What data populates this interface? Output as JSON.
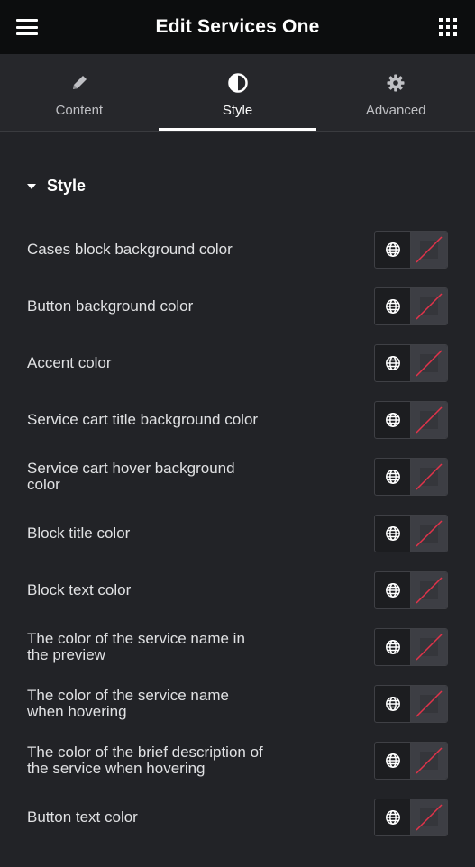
{
  "header": {
    "title": "Edit Services One",
    "menu_icon": "hamburger-icon",
    "apps_icon": "grid-icon"
  },
  "tabs": [
    {
      "label": "Content",
      "icon": "pencil-icon",
      "active": false
    },
    {
      "label": "Style",
      "icon": "half-circle-icon",
      "active": true
    },
    {
      "label": "Advanced",
      "icon": "gear-icon",
      "active": false
    }
  ],
  "section": {
    "title": "Style"
  },
  "controls": [
    {
      "label": "Cases block background color"
    },
    {
      "label": "Button background color"
    },
    {
      "label": "Accent color"
    },
    {
      "label": "Service cart title background color"
    },
    {
      "label": "Service cart hover background color"
    },
    {
      "label": "Block title color"
    },
    {
      "label": "Block text color"
    },
    {
      "label": "The color of the service name in the preview"
    },
    {
      "label": "The color of the service name when hovering"
    },
    {
      "label": "The color of the brief description of the service when hovering"
    },
    {
      "label": "Button text color"
    }
  ],
  "colors": {
    "header_bg": "#0c0d0e",
    "panel_bg": "#222327",
    "tabs_bg": "#26272b",
    "swatch_bg": "#3d3e44",
    "no_color_line": "#e3334a"
  }
}
